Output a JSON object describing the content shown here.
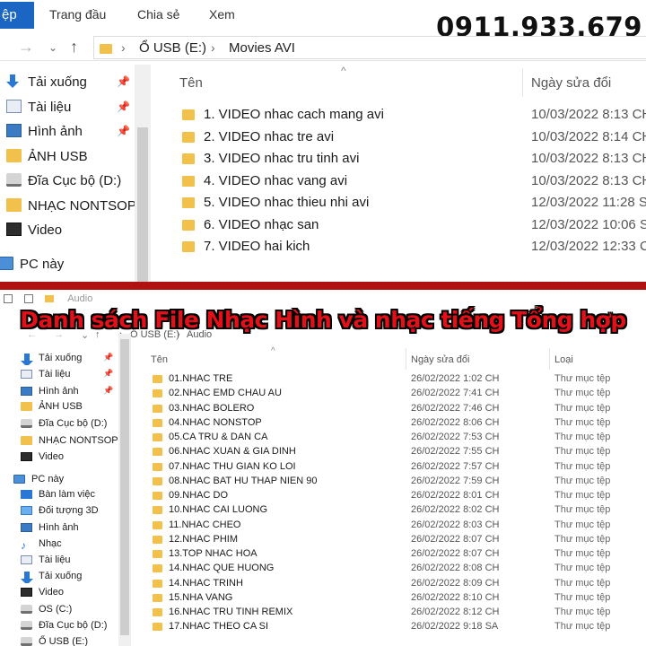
{
  "top": {
    "ribbon": {
      "file_tab": "ệp",
      "tabs": [
        "Trang đầu",
        "Chia sẻ",
        "Xem"
      ]
    },
    "phone": "0911.933.679",
    "breadcrumb": [
      "Ổ USB (E:)",
      "Movies AVI"
    ],
    "nav": [
      {
        "label": "Tải xuống",
        "icon": "download-icon",
        "pinned": true
      },
      {
        "label": "Tài liệu",
        "icon": "document-icon",
        "pinned": true
      },
      {
        "label": "Hình ảnh",
        "icon": "pictures-icon",
        "pinned": true
      },
      {
        "label": "ẢNH USB",
        "icon": "folder-icon",
        "pinned": false
      },
      {
        "label": "Đĩa Cục bộ (D:)",
        "icon": "drive-icon",
        "pinned": false
      },
      {
        "label": "NHẠC NONTSOP",
        "icon": "folder-icon",
        "pinned": false
      },
      {
        "label": "Video",
        "icon": "video-icon",
        "pinned": false
      },
      {
        "label": "PC này",
        "icon": "pc-icon",
        "pinned": false
      }
    ],
    "columns": {
      "name": "Tên",
      "date": "Ngày sửa đổi"
    },
    "files": [
      {
        "name": "1. VIDEO nhac cach mang avi",
        "date": "10/03/2022 8:13 CH"
      },
      {
        "name": "2. VIDEO nhac tre avi",
        "date": "10/03/2022 8:14 CH"
      },
      {
        "name": "3. VIDEO nhac tru tinh avi",
        "date": "10/03/2022 8:13 CH"
      },
      {
        "name": "4. VIDEO nhac vang avi",
        "date": "10/03/2022 8:13 CH"
      },
      {
        "name": "5. VIDEO nhac thieu nhi avi",
        "date": "12/03/2022 11:28 SA"
      },
      {
        "name": "6. VIDEO nhạc san",
        "date": "12/03/2022 10:06 SA"
      },
      {
        "name": "7. VIDEO hai kich",
        "date": "12/03/2022 12:33 CH"
      }
    ]
  },
  "banner_title": "Danh sách File Nhạc Hình và nhạc tiếng Tổng hợp",
  "bottom": {
    "qa_title": "Audio",
    "breadcrumb": [
      "Ổ USB (E:)",
      "Audio"
    ],
    "nav": [
      {
        "label": "Tải xuống",
        "icon": "download-icon",
        "pinned": true
      },
      {
        "label": "Tài liệu",
        "icon": "document-icon",
        "pinned": true
      },
      {
        "label": "Hình ảnh",
        "icon": "pictures-icon",
        "pinned": true
      },
      {
        "label": "ẢNH USB",
        "icon": "folder-icon",
        "pinned": false
      },
      {
        "label": "Đĩa Cục bộ (D:)",
        "icon": "drive-icon",
        "pinned": false
      },
      {
        "label": "NHẠC NONTSOP",
        "icon": "folder-icon",
        "pinned": false
      },
      {
        "label": "Video",
        "icon": "video-icon",
        "pinned": false
      },
      {
        "label": "PC này",
        "icon": "pc-icon",
        "pinned": false
      },
      {
        "label": "Bàn làm việc",
        "icon": "desktop-icon",
        "pinned": false
      },
      {
        "label": "Đối tượng 3D",
        "icon": "3d-objects-icon",
        "pinned": false
      },
      {
        "label": "Hình ảnh",
        "icon": "pictures-icon",
        "pinned": false
      },
      {
        "label": "Nhạc",
        "icon": "music-icon",
        "pinned": false
      },
      {
        "label": "Tài liệu",
        "icon": "document-icon",
        "pinned": false
      },
      {
        "label": "Tải xuống",
        "icon": "download-icon",
        "pinned": false
      },
      {
        "label": "Video",
        "icon": "video-icon",
        "pinned": false
      },
      {
        "label": "OS (C:)",
        "icon": "drive-icon",
        "pinned": false
      },
      {
        "label": "Đĩa Cục bộ (D:)",
        "icon": "drive-icon",
        "pinned": false
      },
      {
        "label": "Ổ USB (E:)",
        "icon": "drive-icon",
        "pinned": false
      }
    ],
    "columns": {
      "name": "Tên",
      "date": "Ngày sửa đổi",
      "type": "Loại"
    },
    "files": [
      {
        "name": "01.NHAC TRE",
        "date": "26/02/2022 1:02 CH",
        "type": "Thư mục tệp"
      },
      {
        "name": "02.NHAC EMD CHAU AU",
        "date": "26/02/2022 7:41 CH",
        "type": "Thư mục tệp"
      },
      {
        "name": "03.NHAC BOLERO",
        "date": "26/02/2022 7:46 CH",
        "type": "Thư mục tệp"
      },
      {
        "name": "04.NHAC NONSTOP",
        "date": "26/02/2022 8:06 CH",
        "type": "Thư mục tệp"
      },
      {
        "name": "05.CA TRU & DAN CA",
        "date": "26/02/2022 7:53 CH",
        "type": "Thư mục tệp"
      },
      {
        "name": "06.NHAC XUAN & GIA DINH",
        "date": "26/02/2022 7:55 CH",
        "type": "Thư mục tệp"
      },
      {
        "name": "07.NHAC THU GIAN KO LOI",
        "date": "26/02/2022 7:57 CH",
        "type": "Thư mục tệp"
      },
      {
        "name": "08.NHAC BAT HU THAP NIEN 90",
        "date": "26/02/2022 7:59 CH",
        "type": "Thư mục tệp"
      },
      {
        "name": "09.NHAC DO",
        "date": "26/02/2022 8:01 CH",
        "type": "Thư mục tệp"
      },
      {
        "name": "10.NHAC CAI LUONG",
        "date": "26/02/2022 8:02 CH",
        "type": "Thư mục tệp"
      },
      {
        "name": "11.NHAC CHEO",
        "date": "26/02/2022 8:03 CH",
        "type": "Thư mục tệp"
      },
      {
        "name": "12.NHAC PHIM",
        "date": "26/02/2022 8:07 CH",
        "type": "Thư mục tệp"
      },
      {
        "name": "13.TOP NHAC HOA",
        "date": "26/02/2022 8:07 CH",
        "type": "Thư mục tệp"
      },
      {
        "name": "14.NHAC QUE HUONG",
        "date": "26/02/2022 8:08 CH",
        "type": "Thư mục tệp"
      },
      {
        "name": "14.NHAC TRINH",
        "date": "26/02/2022 8:09 CH",
        "type": "Thư mục tệp"
      },
      {
        "name": "15.NHA VANG",
        "date": "26/02/2022 8:10 CH",
        "type": "Thư mục tệp"
      },
      {
        "name": "16.NHAC TRU TINH REMIX",
        "date": "26/02/2022 8:12 CH",
        "type": "Thư mục tệp"
      },
      {
        "name": "17.NHAC THEO CA SI",
        "date": "26/02/2022 9:18 SA",
        "type": "Thư mục tệp"
      }
    ]
  }
}
